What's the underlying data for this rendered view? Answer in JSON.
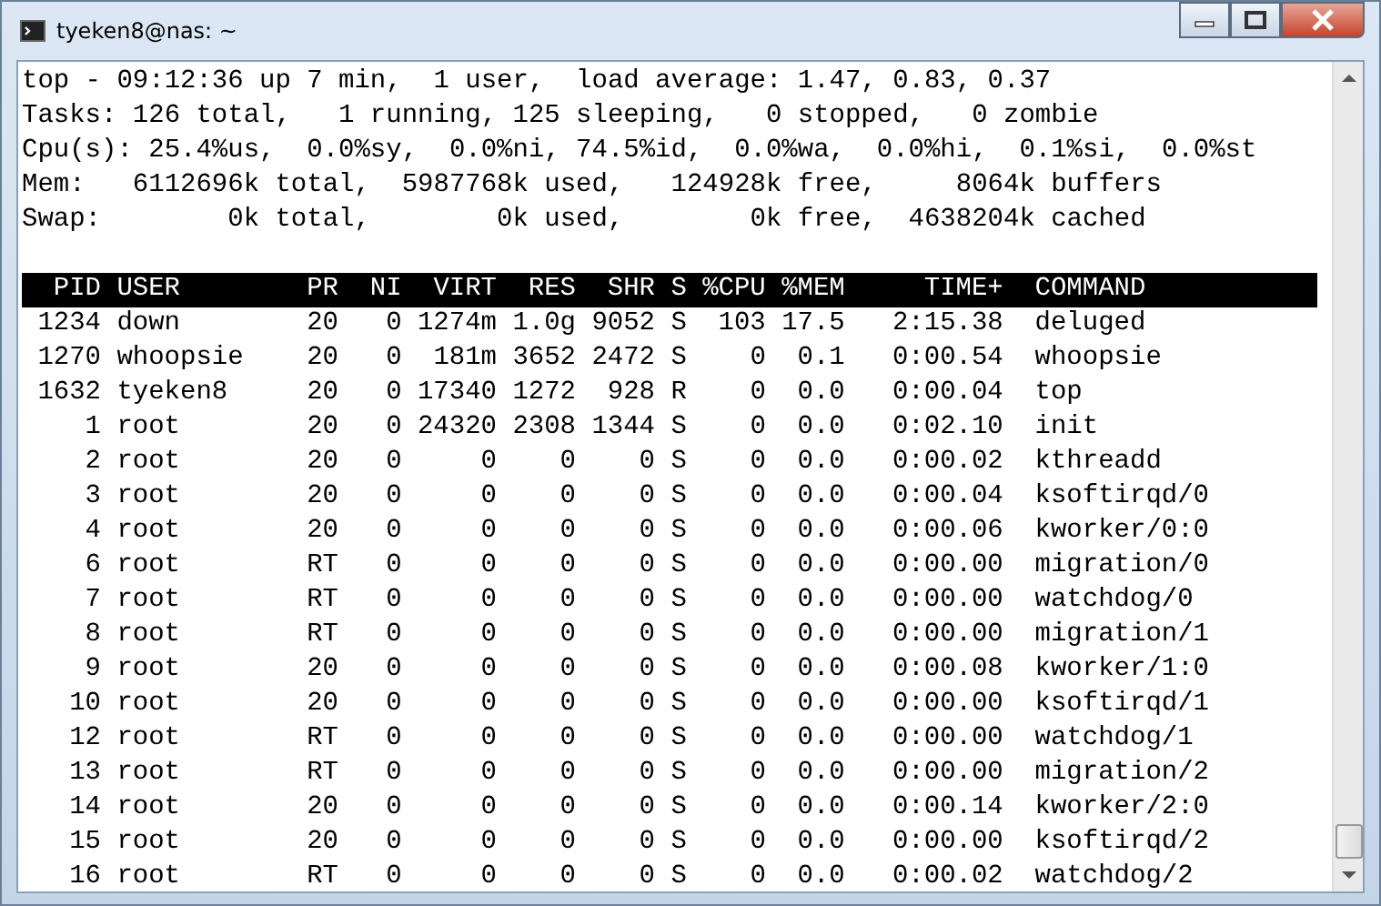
{
  "window": {
    "title": "tyeken8@nas: ~"
  },
  "summary": [
    "top - 09:12:36 up 7 min,  1 user,  load average: 1.47, 0.83, 0.37",
    "Tasks: 126 total,   1 running, 125 sleeping,   0 stopped,   0 zombie",
    "Cpu(s): 25.4%us,  0.0%sy,  0.0%ni, 74.5%id,  0.0%wa,  0.0%hi,  0.1%si,  0.0%st",
    "Mem:   6112696k total,  5987768k used,   124928k free,     8064k buffers",
    "Swap:        0k total,        0k used,        0k free,  4638204k cached"
  ],
  "table": {
    "columns": [
      "PID",
      "USER",
      "PR",
      "NI",
      "VIRT",
      "RES",
      "SHR",
      "S",
      "%CPU",
      "%MEM",
      "TIME+",
      "COMMAND"
    ],
    "rows": [
      [
        "1234",
        "down",
        "20",
        "0",
        "1274m",
        "1.0g",
        "9052",
        "S",
        "103",
        "17.5",
        "2:15.38",
        "deluged"
      ],
      [
        "1270",
        "whoopsie",
        "20",
        "0",
        "181m",
        "3652",
        "2472",
        "S",
        "0",
        "0.1",
        "0:00.54",
        "whoopsie"
      ],
      [
        "1632",
        "tyeken8",
        "20",
        "0",
        "17340",
        "1272",
        "928",
        "R",
        "0",
        "0.0",
        "0:00.04",
        "top"
      ],
      [
        "1",
        "root",
        "20",
        "0",
        "24320",
        "2308",
        "1344",
        "S",
        "0",
        "0.0",
        "0:02.10",
        "init"
      ],
      [
        "2",
        "root",
        "20",
        "0",
        "0",
        "0",
        "0",
        "S",
        "0",
        "0.0",
        "0:00.02",
        "kthreadd"
      ],
      [
        "3",
        "root",
        "20",
        "0",
        "0",
        "0",
        "0",
        "S",
        "0",
        "0.0",
        "0:00.04",
        "ksoftirqd/0"
      ],
      [
        "4",
        "root",
        "20",
        "0",
        "0",
        "0",
        "0",
        "S",
        "0",
        "0.0",
        "0:00.06",
        "kworker/0:0"
      ],
      [
        "6",
        "root",
        "RT",
        "0",
        "0",
        "0",
        "0",
        "S",
        "0",
        "0.0",
        "0:00.00",
        "migration/0"
      ],
      [
        "7",
        "root",
        "RT",
        "0",
        "0",
        "0",
        "0",
        "S",
        "0",
        "0.0",
        "0:00.00",
        "watchdog/0"
      ],
      [
        "8",
        "root",
        "RT",
        "0",
        "0",
        "0",
        "0",
        "S",
        "0",
        "0.0",
        "0:00.00",
        "migration/1"
      ],
      [
        "9",
        "root",
        "20",
        "0",
        "0",
        "0",
        "0",
        "S",
        "0",
        "0.0",
        "0:00.08",
        "kworker/1:0"
      ],
      [
        "10",
        "root",
        "20",
        "0",
        "0",
        "0",
        "0",
        "S",
        "0",
        "0.0",
        "0:00.00",
        "ksoftirqd/1"
      ],
      [
        "12",
        "root",
        "RT",
        "0",
        "0",
        "0",
        "0",
        "S",
        "0",
        "0.0",
        "0:00.00",
        "watchdog/1"
      ],
      [
        "13",
        "root",
        "RT",
        "0",
        "0",
        "0",
        "0",
        "S",
        "0",
        "0.0",
        "0:00.00",
        "migration/2"
      ],
      [
        "14",
        "root",
        "20",
        "0",
        "0",
        "0",
        "0",
        "S",
        "0",
        "0.0",
        "0:00.14",
        "kworker/2:0"
      ],
      [
        "15",
        "root",
        "20",
        "0",
        "0",
        "0",
        "0",
        "S",
        "0",
        "0.0",
        "0:00.00",
        "ksoftirqd/2"
      ],
      [
        "16",
        "root",
        "RT",
        "0",
        "0",
        "0",
        "0",
        "S",
        "0",
        "0.0",
        "0:00.02",
        "watchdog/2"
      ]
    ]
  }
}
